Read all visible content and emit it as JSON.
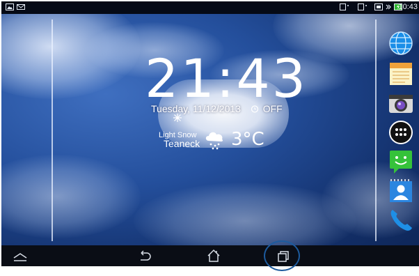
{
  "status_bar": {
    "time": "10:43"
  },
  "clock_widget": {
    "time": "21:43",
    "date": "Tuesday, 11/12/2013",
    "alarm": "OFF"
  },
  "weather_widget": {
    "condition": "Light Snow",
    "city": "Teaneck",
    "temperature": "3°C",
    "icon": "snow-cloud-icon"
  },
  "dock_apps": [
    {
      "name": "browser-app-icon",
      "color": "#1a8ee8"
    },
    {
      "name": "notes-app-icon",
      "color": "#f5d36b"
    },
    {
      "name": "camera-app-icon",
      "color": "#3b3b3b"
    },
    {
      "name": "all-apps-icon",
      "color": "#111111"
    },
    {
      "name": "messaging-app-icon",
      "color": "#35c23a"
    },
    {
      "name": "contacts-app-icon",
      "color": "#2b86e0"
    },
    {
      "name": "phone-app-icon",
      "color": "#1e8fe6"
    }
  ],
  "nav_bar": {
    "buttons": [
      "collapse-icon",
      "back-icon",
      "home-icon",
      "recent-apps-icon"
    ],
    "highlight_color": "#1d5b9e"
  }
}
